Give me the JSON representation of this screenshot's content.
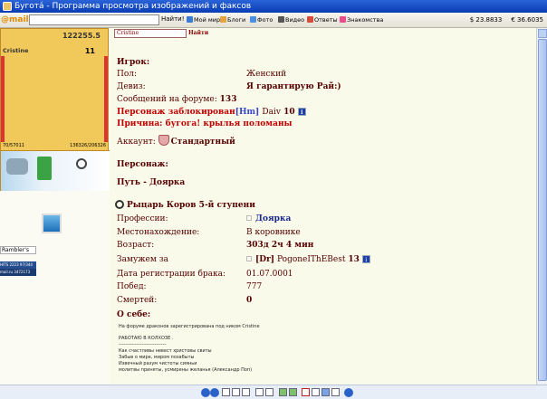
{
  "window": {
    "title": "Буготá - Программа просмотра изображений и факсов"
  },
  "toolbar": {
    "logo": "@mail.ru",
    "search_value": "",
    "find_label": "Найти!",
    "items": [
      "Мой мир",
      "Блоги",
      "Фото",
      "Видео",
      "Ответы",
      "Знакомства"
    ],
    "rates": {
      "usd": "$ 23.8833",
      "eur": "€ 36.6035"
    }
  },
  "sidebar": {
    "gold": "122255.5",
    "nick": "Cristine",
    "level": "11",
    "hp_left": "70/57011",
    "hp_right": "136326/206326",
    "rambler": "Rambler's",
    "counter1": "HITS 2223 97/344",
    "counter2": "mail.ru 3472173"
  },
  "main": {
    "search_value": "Cristine",
    "search_button": "Найти",
    "player_heading": "Игрок:",
    "gender_label": "Пол:",
    "gender_value": "Женский",
    "motto_label": "Девиз:",
    "motto_value": "Я гарантирую Рай:)",
    "posts_label": "Сообщений на форуме:",
    "posts_value": "133",
    "blocked_label": "Персонаж заблокирован",
    "blocked_clan": "[Hm]",
    "blocked_by": "Daiv",
    "blocked_level": "10",
    "reason_label": "Причина: бугога! крылья поломаны",
    "account_label": "Аккаунт:",
    "account_value": "Стандартный",
    "character_heading": "Персонаж:",
    "path_label": "Путь - Доярка",
    "rank_label": "Рыцарь Коров 5-й ступени",
    "profession_label": "Профессии:",
    "profession_value": "Доярка",
    "location_label": "Местонахождение:",
    "location_value": "В коровнике",
    "age_label": "Возраст:",
    "age_value": "303д 2ч 4 мин",
    "married_label": "Замужем за",
    "married_clan": "[Dr]",
    "married_name": "PogoneIThEBest",
    "married_level": "13",
    "marriage_date_label": "Дата регистрации брака:",
    "marriage_date_value": "01.07.0001",
    "wins_label": "Побед:",
    "wins_value": "777",
    "deaths_label": "Смертей:",
    "deaths_value": "0",
    "about_heading": "О себе:",
    "about_line1": "На форуме драконов зарегистрирована под ником Cristine",
    "about_line2": "РАБОТАЮ В КОЛХОЗЕ .",
    "about_line3": "-----------------------------",
    "about_line4": "Как счастливы невест христовы свиты",
    "about_line5": "Забыв о мире, миром позабыты",
    "about_line6": "Извечный разум чистоты сияньи",
    "about_line7": "молитвы приняты, усмирены желанья (Александр Поп)"
  },
  "colors": {
    "accent": "#550000",
    "red": "#c00000",
    "sidebar_gold": "#f1c95a"
  }
}
